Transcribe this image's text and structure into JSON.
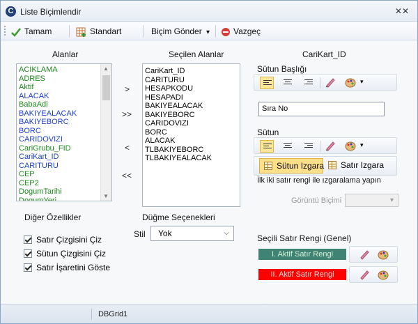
{
  "window": {
    "title": "Liste Biçimlendir",
    "close_label": "✕✕"
  },
  "toolbar": {
    "ok_label": "Tamam",
    "standard_label": "Standart",
    "send_format_label": "Biçim Gönder",
    "send_format_arrow": "▾",
    "cancel_label": "Vazgeç"
  },
  "fields": {
    "heading": "Alanlar",
    "items": [
      {
        "label": "ACIKLAMA",
        "color": "#1a8a1a"
      },
      {
        "label": "ADRES",
        "color": "#1a8a1a"
      },
      {
        "label": "Aktif",
        "color": "#1a8a1a"
      },
      {
        "label": "ALACAK",
        "color": "#1a3fd0"
      },
      {
        "label": "BabaAdi",
        "color": "#1a8a1a"
      },
      {
        "label": "BAKIYEALACAK",
        "color": "#1a3fd0"
      },
      {
        "label": "BAKIYEBORC",
        "color": "#1a3fd0"
      },
      {
        "label": "BORC",
        "color": "#1a3fd0"
      },
      {
        "label": "CARIDOVIZI",
        "color": "#1a3fd0"
      },
      {
        "label": "CariGrubu_FID",
        "color": "#1a8a1a"
      },
      {
        "label": "CariKart_ID",
        "color": "#1a3fd0"
      },
      {
        "label": "CARITURU",
        "color": "#1a3fd0"
      },
      {
        "label": "CEP",
        "color": "#1a8a1a"
      },
      {
        "label": "CEP2",
        "color": "#1a8a1a"
      },
      {
        "label": "DogumTarihi",
        "color": "#1a8a1a"
      },
      {
        "label": "DogumYeri",
        "color": "#1a8a1a"
      }
    ]
  },
  "move_buttons": {
    "add": ">",
    "add_all": ">>",
    "remove": "<",
    "remove_all": "<<"
  },
  "selected": {
    "heading": "Seçilen Alanlar",
    "items": [
      "CariKart_ID",
      "CARITURU",
      "HESAPKODU",
      "HESAPADI",
      "BAKIYEALACAK",
      "BAKIYEBORC",
      "CARIDOVIZI",
      "BORC",
      "ALACAK",
      "TLBAKIYEBORC",
      "TLBAKIYEALACAK"
    ]
  },
  "other": {
    "heading": "Diğer Özellikler",
    "options": [
      "Satır Çizgisini Çiz",
      "Sütun Çizgisini Çiz",
      "Satır İşaretini Göste"
    ]
  },
  "button_options": {
    "heading": "Düğme Seçenekleri",
    "style_label": "Stil",
    "style_value": "Yok"
  },
  "props": {
    "field_name": "CariKart_ID",
    "column_header_label": "Sütun Başlığı",
    "column_header_value": "Sıra No",
    "column_label": "Sütun",
    "column_grid_label": "Sütun Izgara",
    "row_grid_label": "Satır Izgara",
    "striping_note": "İlk iki satır rengi ile ızgaralama yapın",
    "view_format_label": "Görüntü Biçimi",
    "selected_row_color_label": "Seçili Satır Rengi (Genel)",
    "active_row_1": "I. Aktif Satır Rengi",
    "active_row_2": "II. Aktif Satır Rengi",
    "active_row_1_color": "#3f8374",
    "active_row_2_color": "#ff0000"
  },
  "status": {
    "text": "DBGrid1"
  }
}
